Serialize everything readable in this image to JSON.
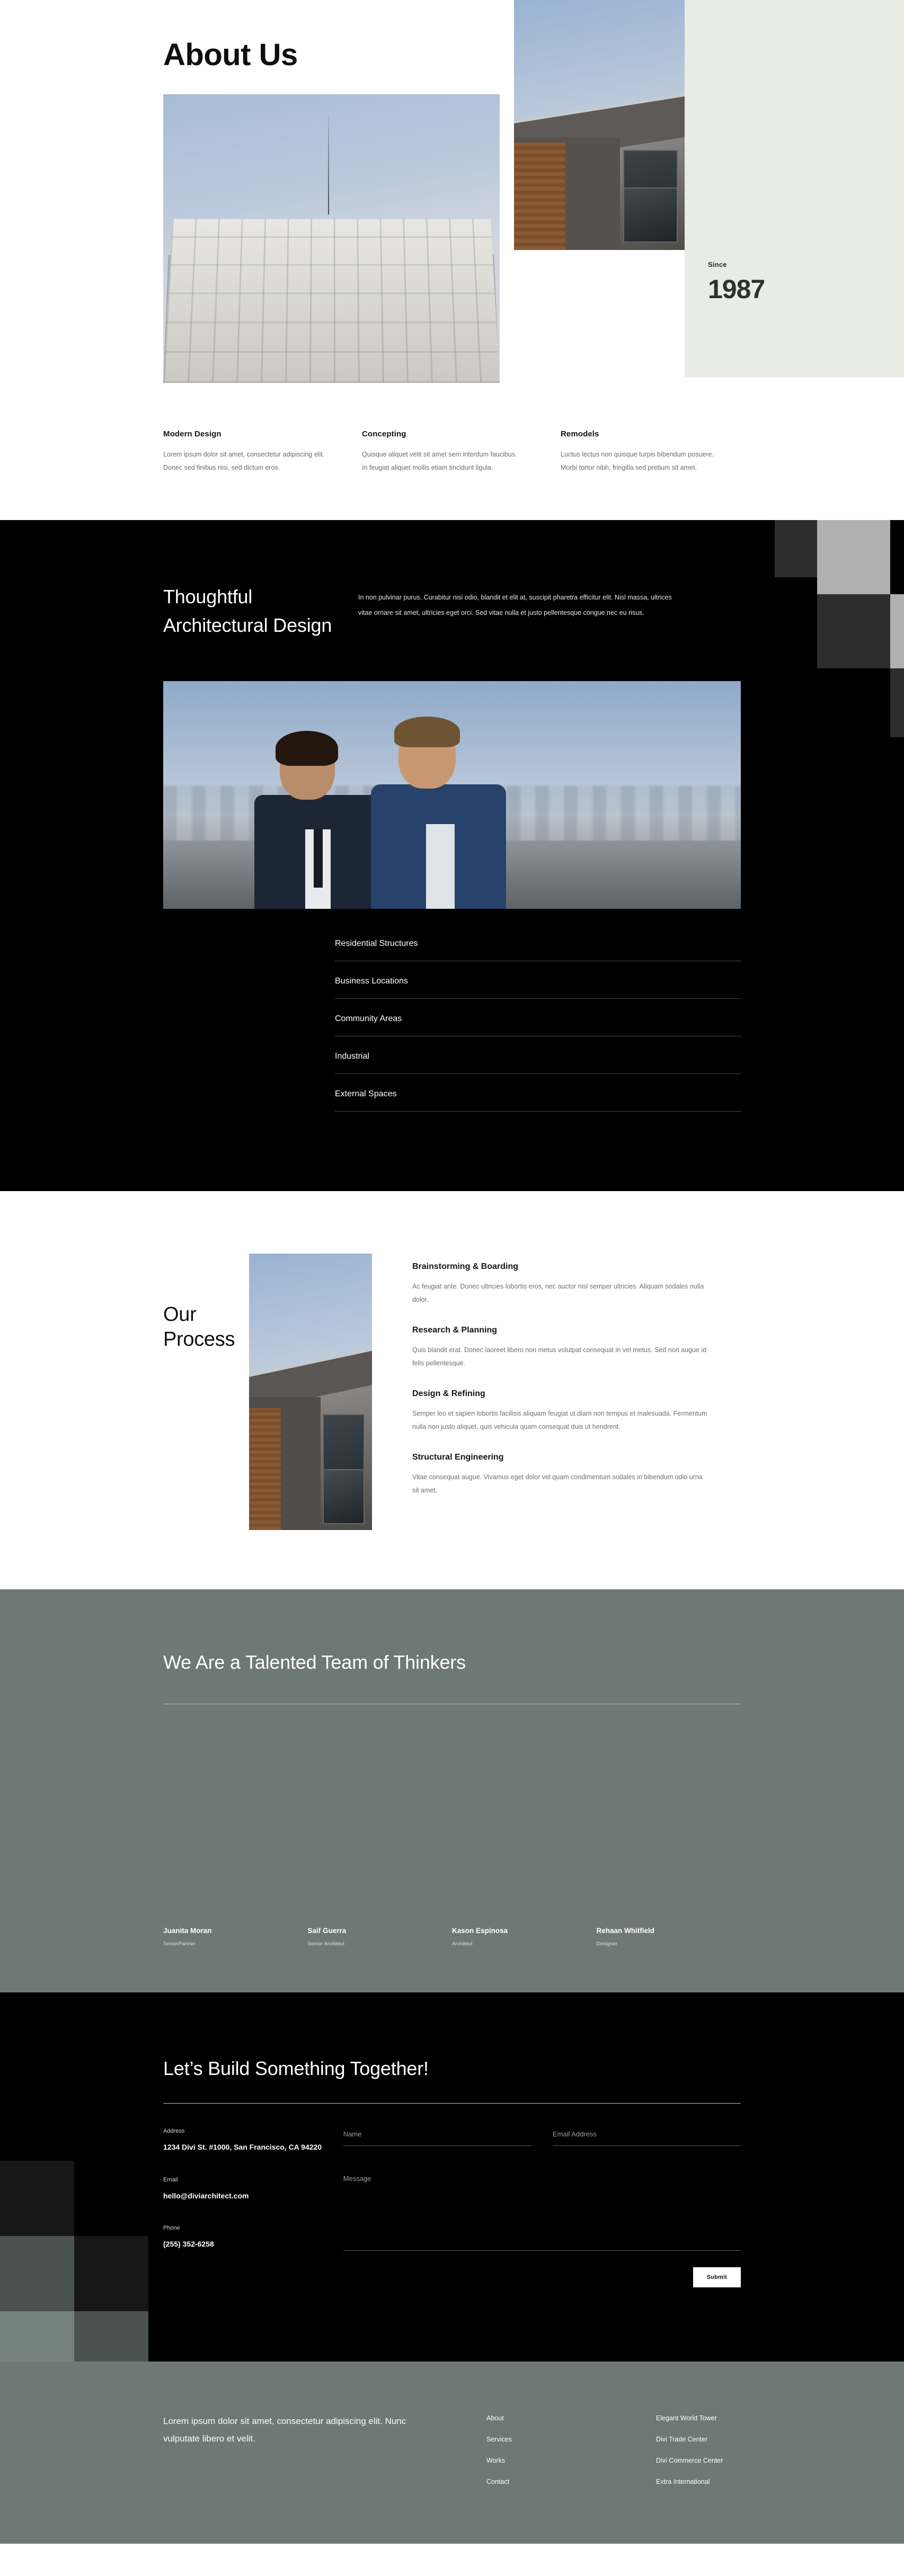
{
  "about": {
    "title": "About Us",
    "since_label": "Since",
    "since_year": "1987",
    "features": [
      {
        "heading": "Modern Design",
        "body": "Lorem ipsum dolor sit amet, consectetur adipiscing elit. Donec sed finibus nisi, sed dictum eros."
      },
      {
        "heading": "Concepting",
        "body": "Quisque aliquet velit sit amet sem interdum faucibus. In feugiat aliquet mollis etiam tincidunt ligula."
      },
      {
        "heading": "Remodels",
        "body": "Luctus lectus non quisque turpis bibendum posuere. Morbi tortor nibh, fringilla sed pretium sit amet."
      }
    ]
  },
  "dark": {
    "title": "Thoughtful Architectural Design",
    "paragraph": "In non pulvinar purus. Curabitur nisi odio, blandit et elit at, suscipit pharetra efficitur elit. Nisl massa, ultrices vitae ornare sit amet, ultricies eget orci. Sed vitae nulla et justo pellentesque congue nec eu risus.",
    "list": [
      "Residential Structures",
      "Business Locations",
      "Community Areas",
      "Industrial",
      "External Spaces"
    ]
  },
  "process": {
    "title": "Our Process",
    "steps": [
      {
        "heading": "Brainstorming & Boarding",
        "body": "Ac feugiat ante. Donec ultricies lobortis eros, nec auctor nisl semper ultricies. Aliquam sodales nulla dolor."
      },
      {
        "heading": "Research & Planning",
        "body": "Quis blandit erat. Donec laoreet libero non metus volutpat consequat in vel metus. Sed non augue id felis pellentesque."
      },
      {
        "heading": "Design & Refining",
        "body": "Semper leo et sapien lobortis facilisis aliquam feugiat ut diam non tempus et malesuada. Fermentum nulla non justo aliquet, quis vehicula quam consequat duis ut hendrerit."
      },
      {
        "heading": "Structural Engineering",
        "body": "Vitae consequat augue. Vivamus eget dolor vel quam condimentum sodales in bibendum odio urna sit amet."
      }
    ]
  },
  "team": {
    "title": "We Are a Talented Team of Thinkers",
    "members": [
      {
        "name": "Juanita Moran",
        "role": "SeniorPartner"
      },
      {
        "name": "Saif Guerra",
        "role": "Senior Architect"
      },
      {
        "name": "Kason Espinosa",
        "role": "Architect"
      },
      {
        "name": "Rehaan Whitfield",
        "role": "Designer"
      }
    ]
  },
  "contact": {
    "title": "Let’s Build Something Together!",
    "address_label": "Address",
    "address_value": "1234 Divi St. #1000, San Francisco, CA 94220",
    "email_label": "Email",
    "email_value": "hello@diviarchitect.com",
    "phone_label": "Phone",
    "phone_value": "(255) 352-6258",
    "form": {
      "name_placeholder": "Name",
      "email_placeholder": "Email Address",
      "message_placeholder": "Message",
      "submit_label": "Submit"
    }
  },
  "footer": {
    "tagline": "Lorem ipsum dolor sit amet, consectetur adipiscing elit. Nunc vulputate libero et velit.",
    "nav_links": [
      "About",
      "Services",
      "Works",
      "Contact"
    ],
    "project_links": [
      "Elegant World Tower",
      "Divi Trade Center",
      "Divi Commerce Center",
      "Extra International"
    ]
  },
  "colors": {
    "dark": "#000000",
    "sage": "#e8ece4",
    "slate_green": "#6e7875",
    "accent_white": "#ffffff"
  }
}
